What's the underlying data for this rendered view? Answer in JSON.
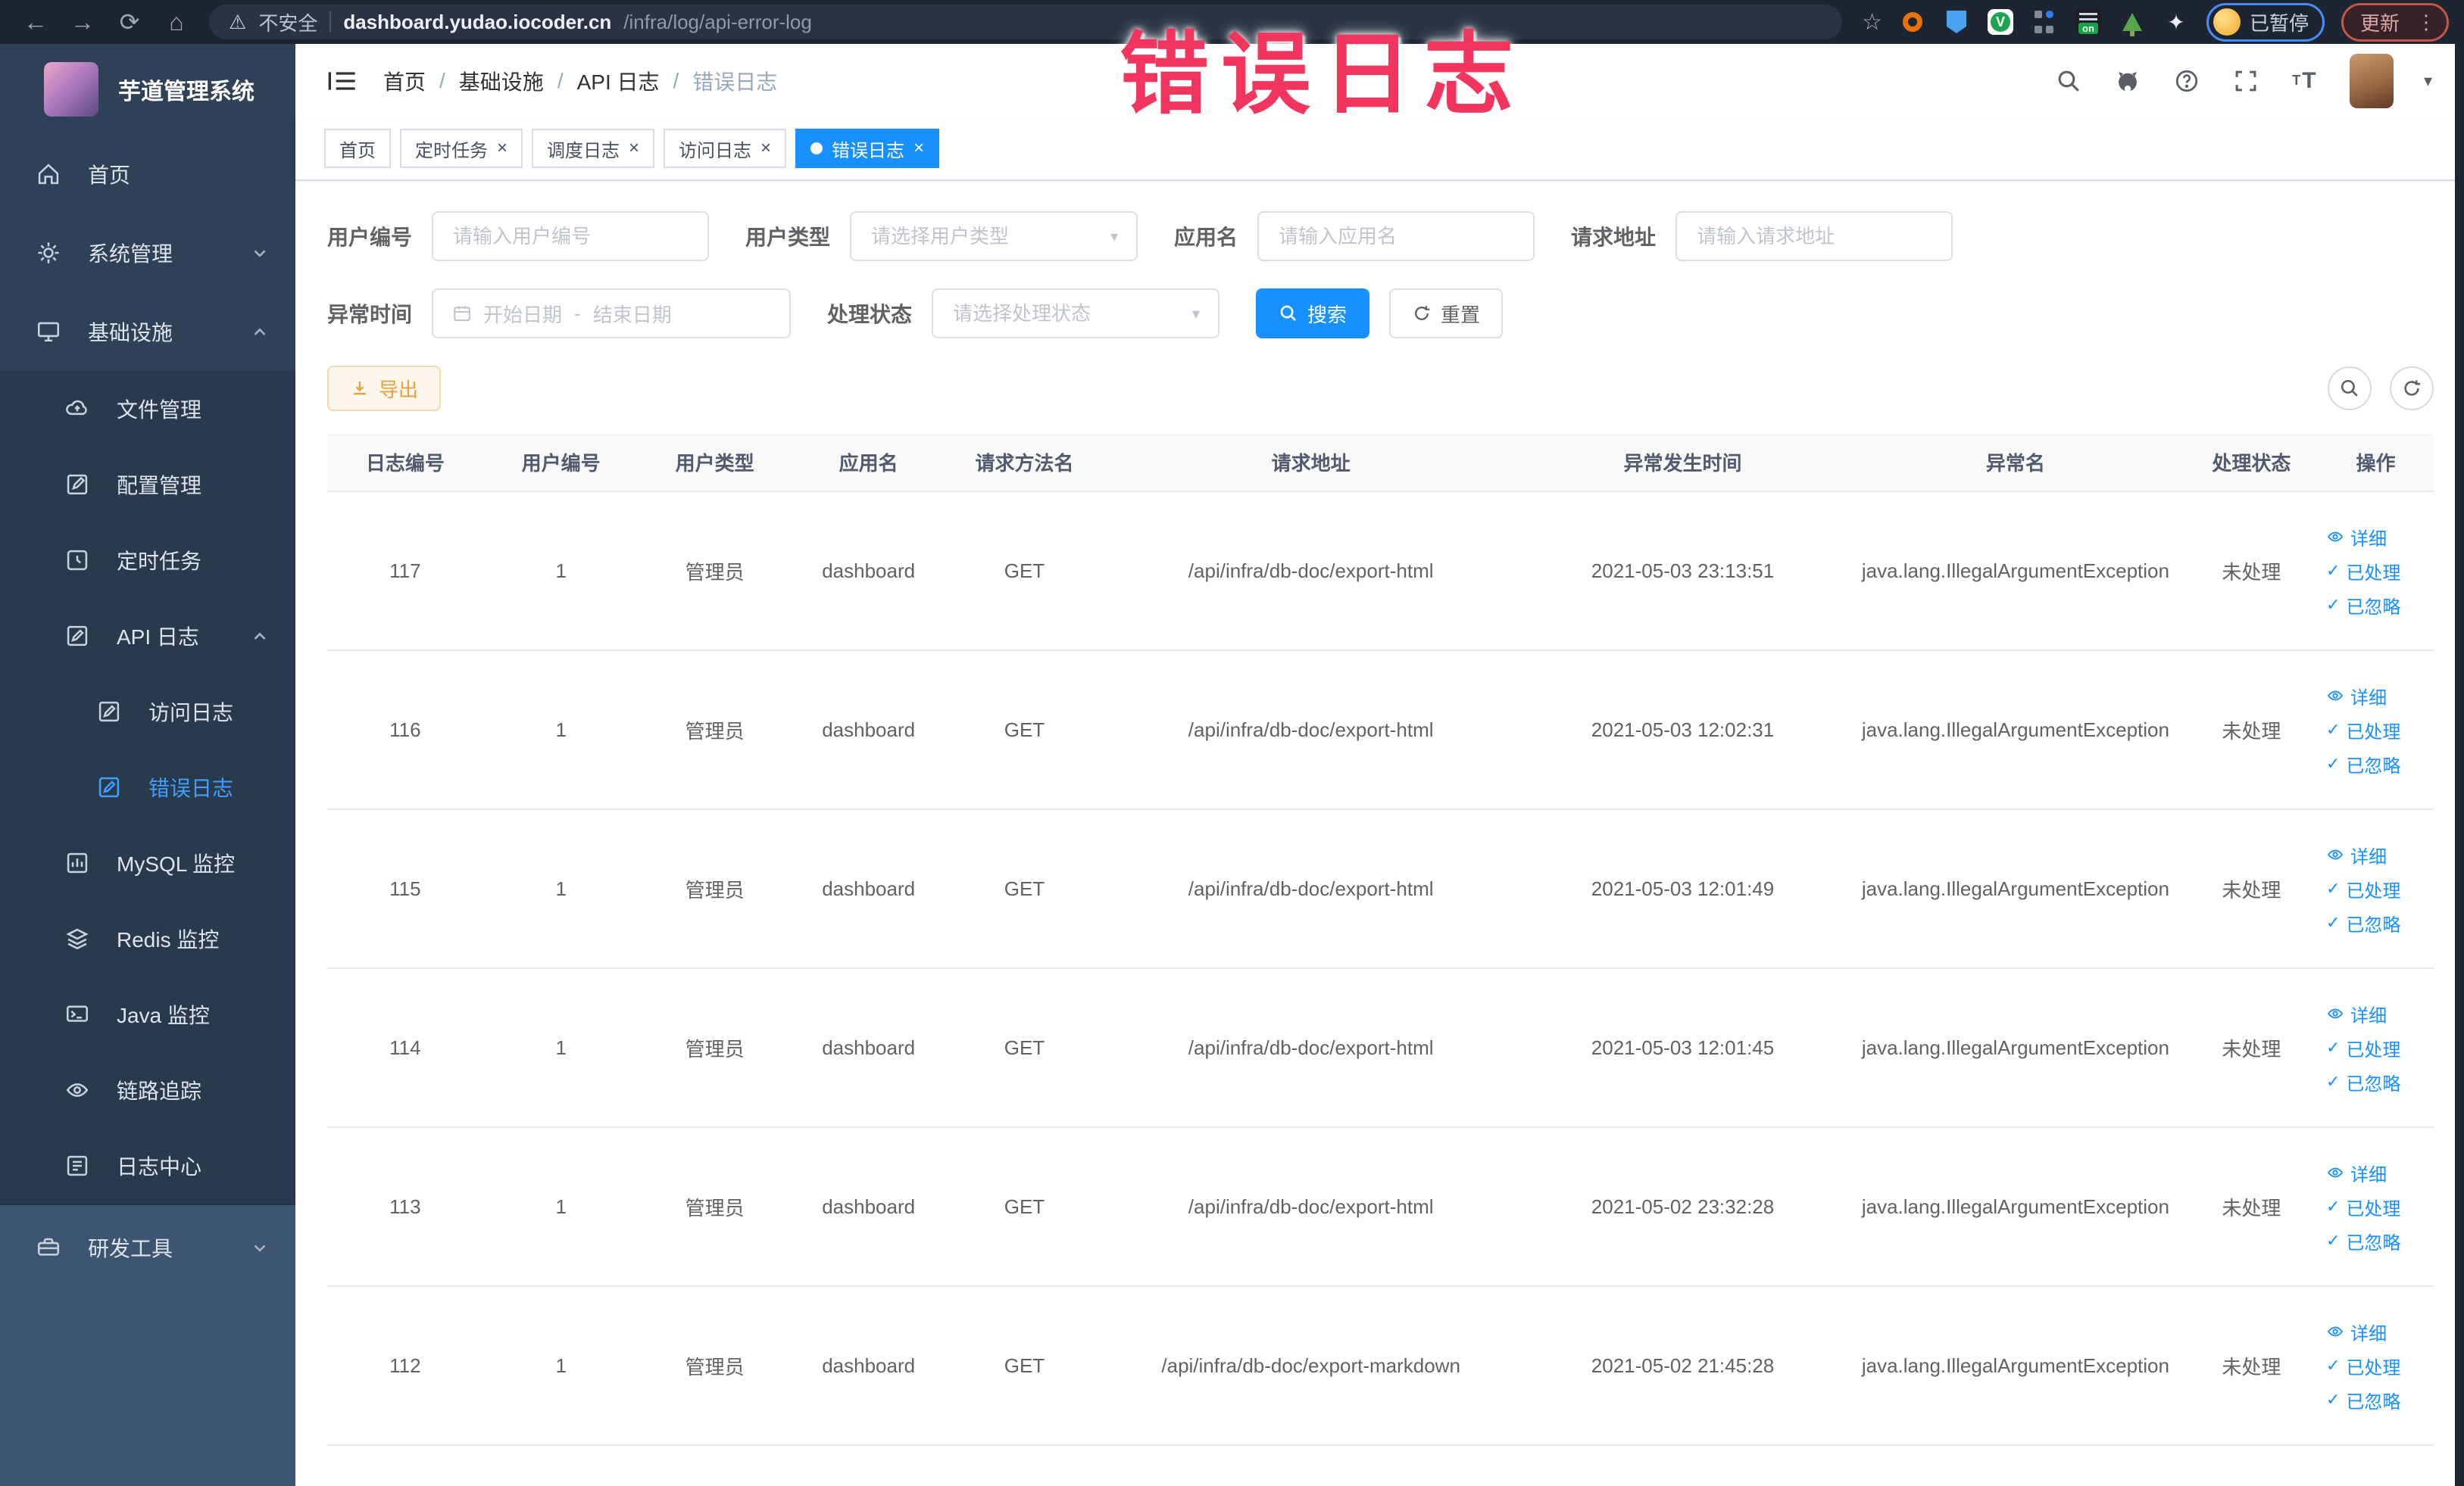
{
  "browser": {
    "security": "不安全",
    "url_host": "dashboard.yudao.iocoder.cn",
    "url_path": "/infra/log/api-error-log",
    "ext_on_badge": "on",
    "paused_badge": "已暂停",
    "update_button": "更新"
  },
  "annotation": {
    "text": "错误日志"
  },
  "sidebar": {
    "title": "芋道管理系统",
    "home": "首页",
    "system": "系统管理",
    "infra": "基础设施",
    "file": "文件管理",
    "config": "配置管理",
    "job": "定时任务",
    "api_log": "API 日志",
    "access_log": "访问日志",
    "error_log": "错误日志",
    "mysql": "MySQL 监控",
    "redis": "Redis 监控",
    "java": "Java 监控",
    "trace": "链路追踪",
    "log_center": "日志中心",
    "dev_tools": "研发工具"
  },
  "breadcrumb": {
    "separator": "/",
    "items": [
      "首页",
      "基础设施",
      "API 日志",
      "错误日志"
    ]
  },
  "tabs": {
    "home": "首页",
    "job": "定时任务",
    "job_log": "调度日志",
    "access_log": "访问日志",
    "error_log": "错误日志"
  },
  "filters": {
    "user_id_label": "用户编号",
    "user_id_placeholder": "请输入用户编号",
    "user_type_label": "用户类型",
    "user_type_placeholder": "请选择用户类型",
    "app_name_label": "应用名",
    "app_name_placeholder": "请输入应用名",
    "request_url_label": "请求地址",
    "request_url_placeholder": "请输入请求地址",
    "time_label": "异常时间",
    "time_start_placeholder": "开始日期",
    "time_separator": "-",
    "time_end_placeholder": "结束日期",
    "status_label": "处理状态",
    "status_placeholder": "请选择处理状态",
    "search_button": "搜索",
    "reset_button": "重置"
  },
  "toolbar": {
    "export_button": "导出"
  },
  "table": {
    "columns": [
      "日志编号",
      "用户编号",
      "用户类型",
      "应用名",
      "请求方法名",
      "请求地址",
      "异常发生时间",
      "异常名",
      "处理状态",
      "操作"
    ],
    "actions": {
      "detail": "详细",
      "processed": "已处理",
      "ignored": "已忽略"
    },
    "rows": [
      {
        "id": "117",
        "user_id": "1",
        "user_type": "管理员",
        "app": "dashboard",
        "method": "GET",
        "url": "/api/infra/db-doc/export-html",
        "time": "2021-05-03 23:13:51",
        "exception": "java.lang.IllegalArgumentException",
        "status": "未处理"
      },
      {
        "id": "116",
        "user_id": "1",
        "user_type": "管理员",
        "app": "dashboard",
        "method": "GET",
        "url": "/api/infra/db-doc/export-html",
        "time": "2021-05-03 12:02:31",
        "exception": "java.lang.IllegalArgumentException",
        "status": "未处理"
      },
      {
        "id": "115",
        "user_id": "1",
        "user_type": "管理员",
        "app": "dashboard",
        "method": "GET",
        "url": "/api/infra/db-doc/export-html",
        "time": "2021-05-03 12:01:49",
        "exception": "java.lang.IllegalArgumentException",
        "status": "未处理"
      },
      {
        "id": "114",
        "user_id": "1",
        "user_type": "管理员",
        "app": "dashboard",
        "method": "GET",
        "url": "/api/infra/db-doc/export-html",
        "time": "2021-05-03 12:01:45",
        "exception": "java.lang.IllegalArgumentException",
        "status": "未处理"
      },
      {
        "id": "113",
        "user_id": "1",
        "user_type": "管理员",
        "app": "dashboard",
        "method": "GET",
        "url": "/api/infra/db-doc/export-html",
        "time": "2021-05-02 23:32:28",
        "exception": "java.lang.IllegalArgumentException",
        "status": "未处理"
      },
      {
        "id": "112",
        "user_id": "1",
        "user_type": "管理员",
        "app": "dashboard",
        "method": "GET",
        "url": "/api/infra/db-doc/export-markdown",
        "time": "2021-05-02 21:45:28",
        "exception": "java.lang.IllegalArgumentException",
        "status": "未处理"
      }
    ]
  },
  "colors": {
    "primary": "#1890ff",
    "warning": "#e6a23c",
    "annotation_red": "#f2355e",
    "sidebar_bg": "#2f4156"
  }
}
